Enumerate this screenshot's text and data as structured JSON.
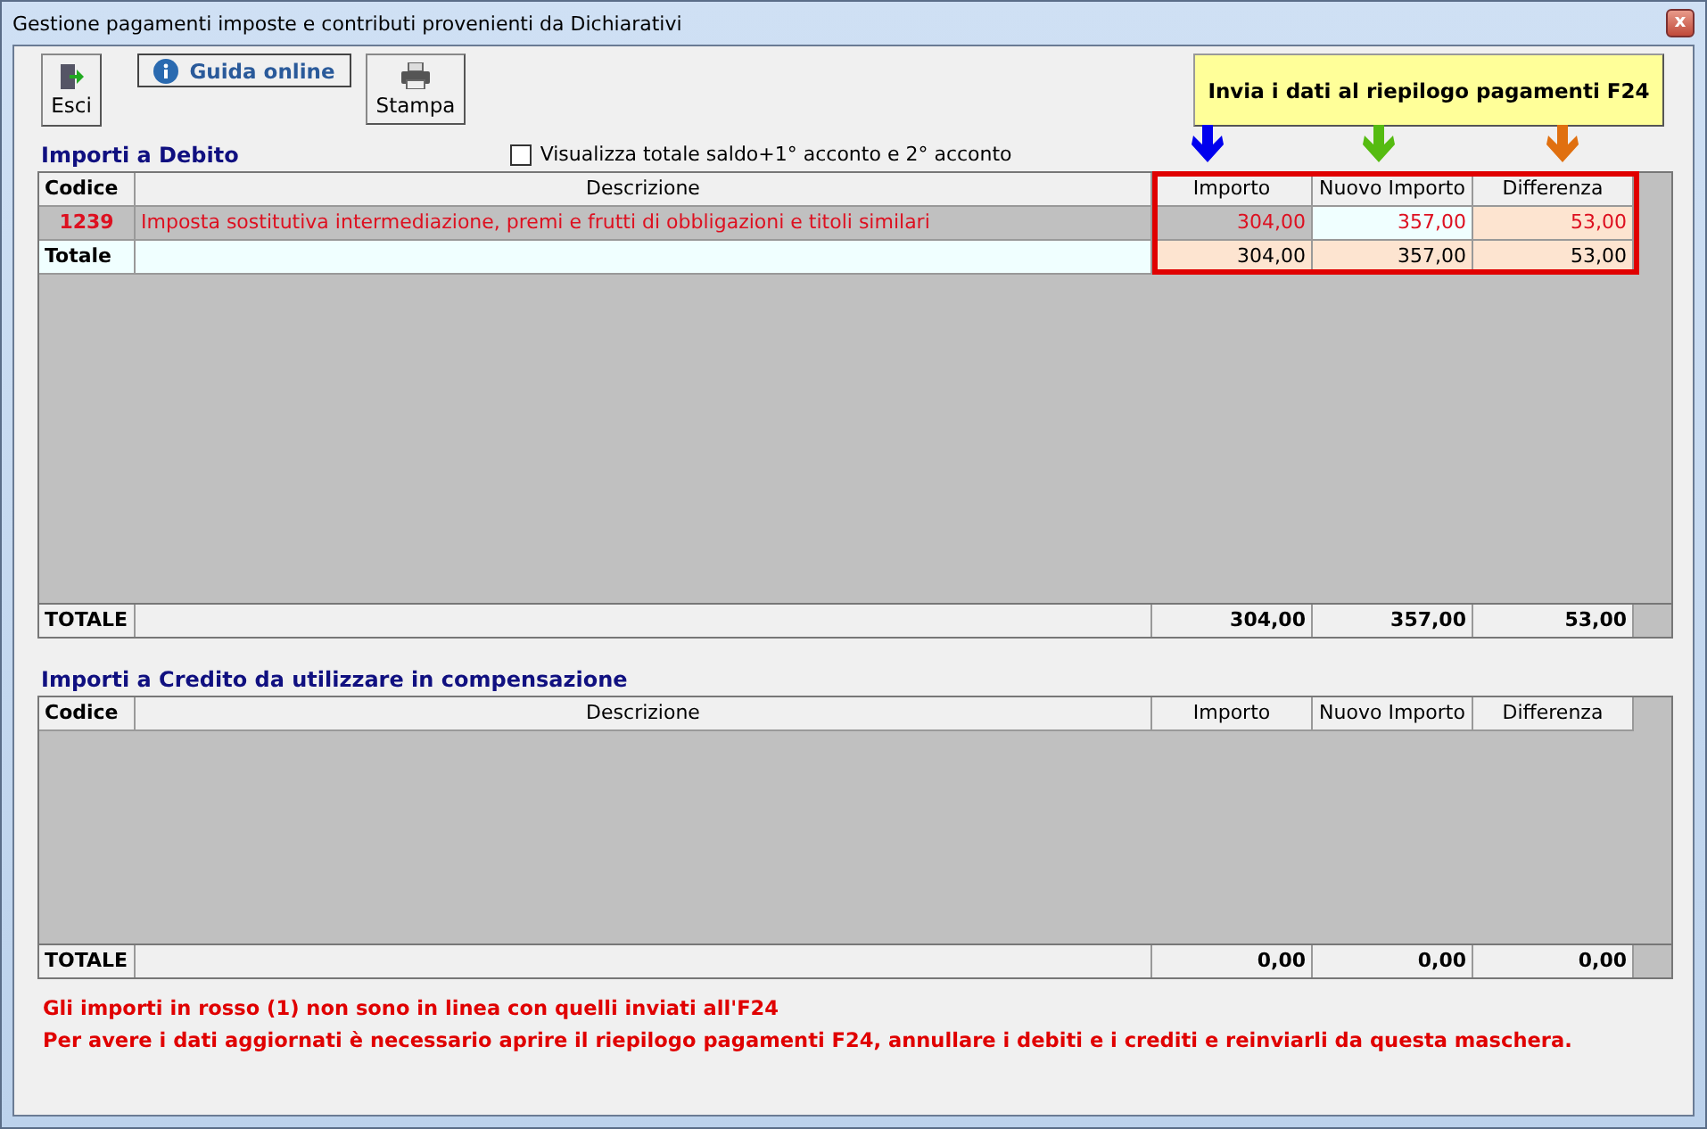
{
  "window": {
    "title": "Gestione pagamenti imposte e contributi provenienti da Dichiarativi",
    "close": "x"
  },
  "toolbar": [
    {
      "kind": "exit",
      "label": "Esci"
    },
    {
      "kind": "help",
      "label": "Guida online"
    },
    {
      "kind": "print",
      "label": "Stampa"
    }
  ],
  "send_button": "Invia i dati al riepilogo pagamenti F24",
  "debit": {
    "title": "Importi a Debito",
    "option": {
      "label": "Visualizza totale saldo+1° acconto e 2° acconto",
      "checked": false
    },
    "column_markers": [
      {
        "color": "#0000ee"
      },
      {
        "color": "#55bb11"
      },
      {
        "color": "#e07010"
      }
    ],
    "columns": [
      "Codice",
      "Descrizione",
      "Importo",
      "Nuovo Importo",
      "Differenza"
    ],
    "rows": [
      {
        "kind": "item",
        "mismatch": true,
        "codice": "1239",
        "descrizione": "Imposta sostitutiva intermediazione, premi e frutti di obbligazioni e titoli similari",
        "importo": "304,00",
        "nuovo": "357,00",
        "differenza": "53,00"
      },
      {
        "kind": "subtotal",
        "mismatch": false,
        "codice": "Totale",
        "importo": "304,00",
        "nuovo": "357,00",
        "differenza": "53,00"
      }
    ],
    "total": {
      "label": "TOTALE",
      "importo": "304,00",
      "nuovo": "357,00",
      "differenza": "53,00"
    }
  },
  "credit": {
    "title": "Importi a Credito da utilizzare in compensazione",
    "columns": [
      "Codice",
      "Descrizione",
      "Importo",
      "Nuovo Importo",
      "Differenza"
    ],
    "total": {
      "label": "TOTALE",
      "importo": "0,00",
      "nuovo": "0,00",
      "differenza": "0,00"
    }
  },
  "messages": [
    "Gli importi in rosso (1) non sono in linea con quelli inviati all'F24",
    "Per avere i dati aggiornati è necessario aprire il riepilogo pagamenti F24, annullare i debiti e i crediti e reinviarli da questa maschera."
  ]
}
